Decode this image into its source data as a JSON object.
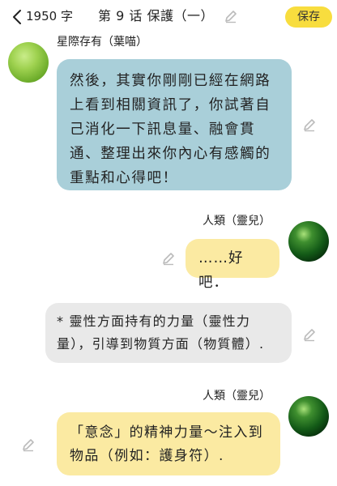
{
  "header": {
    "word_count": "1950 字",
    "chapter_title": "第 9 话  保護（一）",
    "save_label": "保存",
    "colors": {
      "save_button": "#f8dd3e"
    },
    "icons": [
      "chevron-left-icon",
      "pencil-icon"
    ]
  },
  "messages": [
    {
      "sender": "星際存有（葉喵）",
      "side": "left",
      "avatar_icon": "green-leaf-avatar",
      "bubble_color": "#a9cfd9",
      "text": "然後，其實你剛剛已經在網路上看到相關資訊了，你試著自己消化一下訊息量、融會貫通、整理出來你內心有感觸的重點和心得吧！"
    },
    {
      "sender": "人類（靈兒）",
      "side": "right",
      "avatar_icon": "green-orb-avatar",
      "bubble_color": "#fbeaa2",
      "text": "……好吧．"
    },
    {
      "sender": "",
      "side": "narration",
      "bubble_color": "#e9e9e9",
      "text": "*  靈性方面持有的力量（靈性力量），引導到物質方面（物質體）."
    },
    {
      "sender": "人類（靈兒）",
      "side": "right",
      "avatar_icon": "green-orb-avatar",
      "bubble_color": "#fbeaa2",
      "text": "「意念」的精神力量～注入到物品（例如：護身符）."
    }
  ]
}
